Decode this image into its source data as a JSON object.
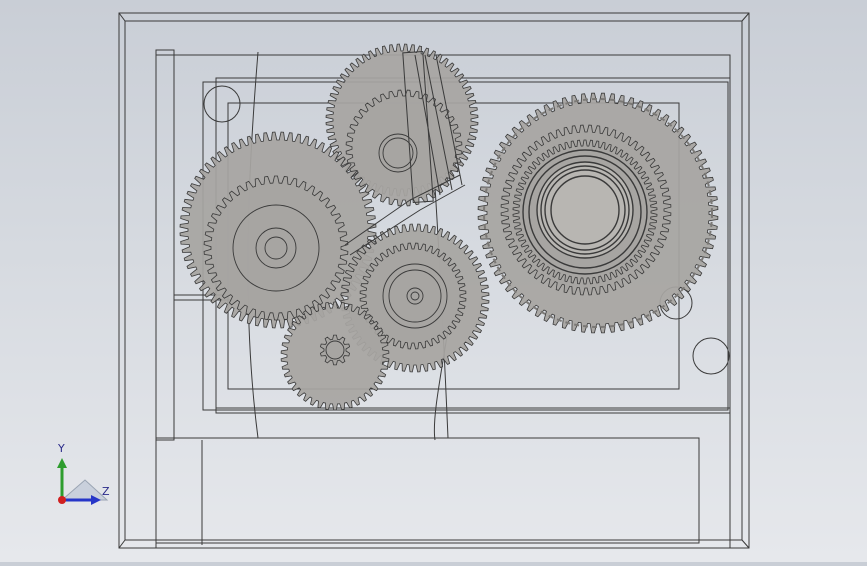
{
  "viewport": {
    "background_top": "#c9ced6",
    "background_bottom": "#e6e8ec",
    "line_color": "#3a3a3a",
    "gear_fill": "#a7a5a1",
    "gear_fill_light": "#b5b3af"
  },
  "triad": {
    "y_label": "Y",
    "z_label": "Z",
    "y_color": "#2e9d2e",
    "z_color": "#2636c8",
    "x_color": "#d02020",
    "cone_color": "#c9d0dc"
  },
  "gears": [
    {
      "name": "top-center-gear",
      "teeth": 64
    },
    {
      "name": "small-upper-gear",
      "teeth": 40
    },
    {
      "name": "left-large-gear",
      "teeth": 72
    },
    {
      "name": "left-inner-gear",
      "teeth": 46
    },
    {
      "name": "center-gear",
      "teeth": 60
    },
    {
      "name": "center-inner-gear",
      "teeth": 44
    },
    {
      "name": "bottom-small-gear",
      "teeth": 42
    },
    {
      "name": "pinion",
      "teeth": 10
    },
    {
      "name": "right-large-gear",
      "teeth": 76
    },
    {
      "name": "right-inner-gear",
      "teeth": 64
    },
    {
      "name": "right-ring-gear",
      "teeth": 70
    }
  ]
}
